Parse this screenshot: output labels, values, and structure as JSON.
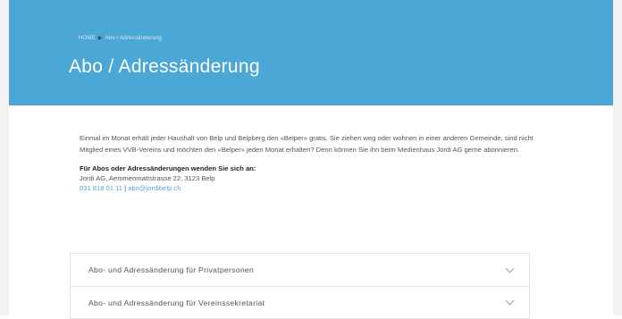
{
  "breadcrumb": {
    "home": "HOME",
    "separator": "▶",
    "current": "Abo / Adressänderung"
  },
  "header": {
    "title": "Abo / Adressänderung"
  },
  "intro": {
    "text": "Einmal im Monat erhält jeder Haushalt von Belp und Belpberg den «Belper» gratis. Sie ziehen weg oder wohnen in einer anderen Gemeinde, sind nicht Mitglied eines VVB-Vereins und möchten den «Belper» jeden Monat erhalten? Denn können Sie ihn beim Medienhaus Jordi AG gerne abonnieren."
  },
  "contact": {
    "heading": "Für Abos oder Adressänderungen wenden Sie sich an:",
    "address": "Jordi AG, Aemmenmattstrasse 22, 3123 Belp",
    "phone": "031 818 01 11",
    "divider": "|",
    "email": "abo@jordibelp.ch"
  },
  "accordion": {
    "items": [
      {
        "label": "Abo- und Adressänderung für Privatpersonen"
      },
      {
        "label": "Abo- und Adressänderung für Vereinssekretariat"
      }
    ]
  },
  "colors": {
    "hero": "#4ba8d6",
    "link": "#5aa4cf"
  },
  "icons": {
    "accordion_toggle": "chevron-down-icon"
  }
}
